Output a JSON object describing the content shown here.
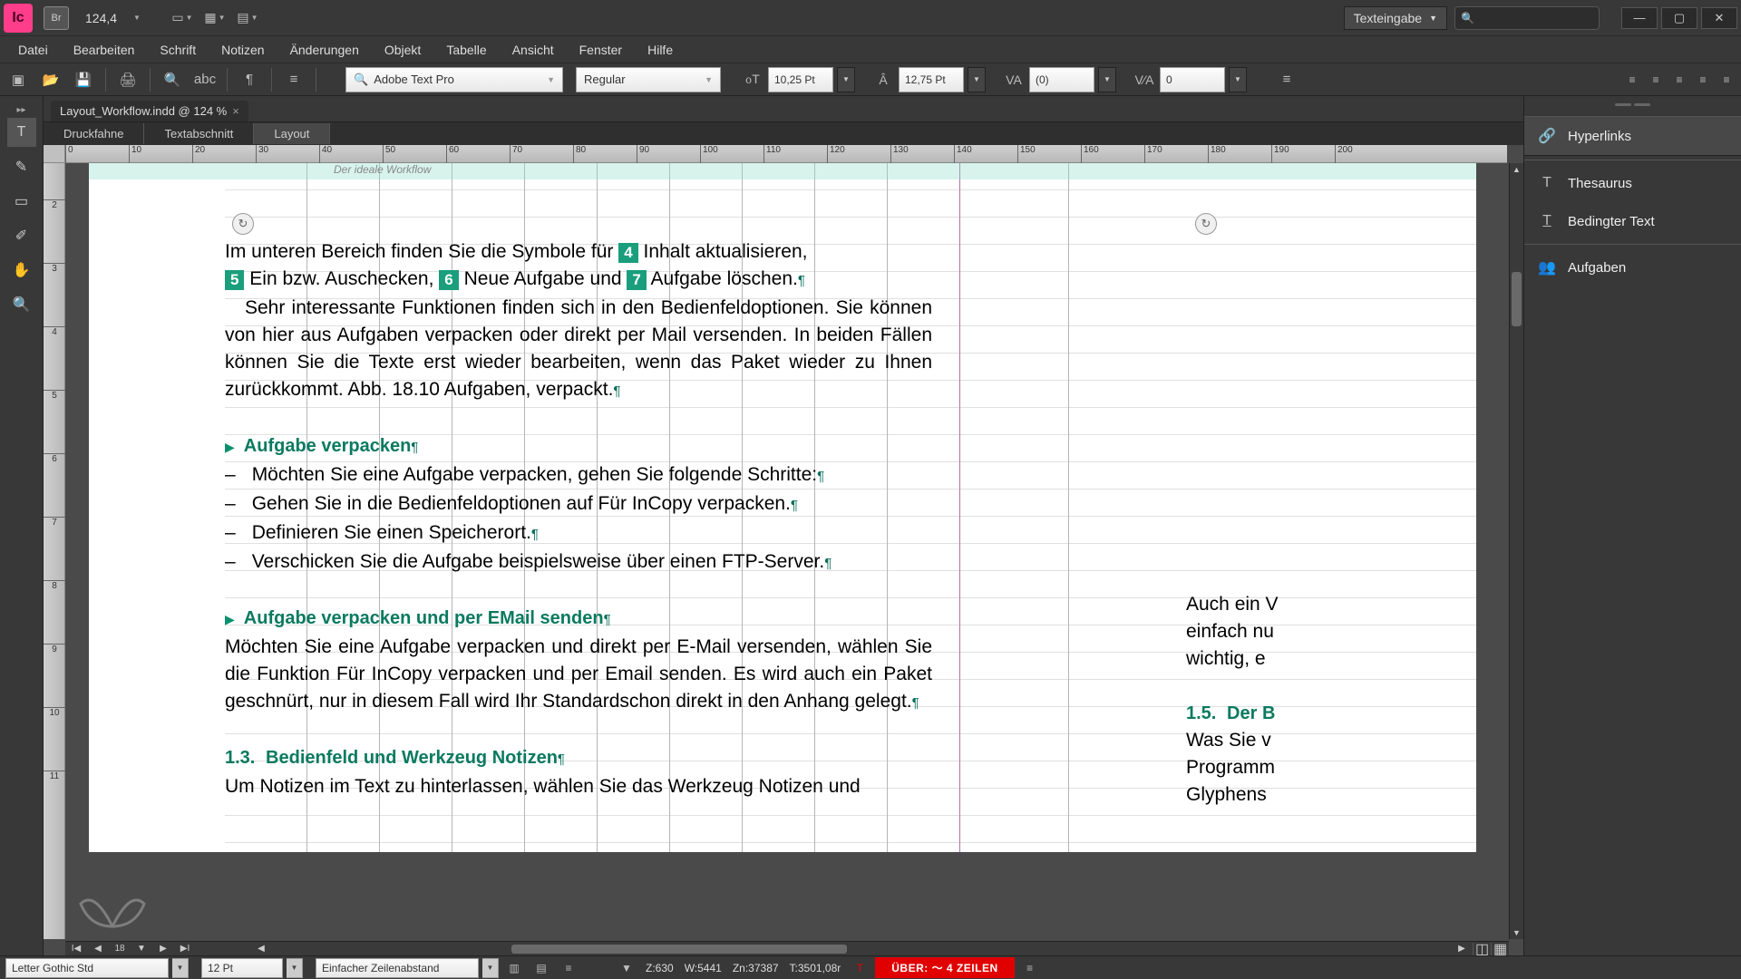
{
  "titlebar": {
    "app": "Ic",
    "bridge": "Br",
    "zoom": "124,4",
    "workspace": "Texteingabe"
  },
  "menu": [
    "Datei",
    "Bearbeiten",
    "Schrift",
    "Notizen",
    "Änderungen",
    "Objekt",
    "Tabelle",
    "Ansicht",
    "Fenster",
    "Hilfe"
  ],
  "control": {
    "font": "Adobe Text Pro",
    "style": "Regular",
    "size": "10,25 Pt",
    "leading": "12,75 Pt",
    "tracking": "(0)",
    "kerning": "0"
  },
  "doc_tab": "Layout_Workflow.indd @ 124 %",
  "view_tabs": [
    "Druckfahne",
    "Textabschnitt",
    "Layout"
  ],
  "page_head": "Der ideale Workflow",
  "ruler_h": [
    "0",
    "10",
    "20",
    "30",
    "40",
    "50",
    "60",
    "70",
    "80",
    "90",
    "100",
    "110",
    "120",
    "130",
    "140",
    "150",
    "160",
    "170",
    "180",
    "190",
    "200"
  ],
  "ruler_v": [
    "2",
    "3",
    "4",
    "5",
    "6",
    "7",
    "8",
    "9",
    "10",
    "11"
  ],
  "text": {
    "line1a": "Im unteren Bereich finden Sie die Symbole für ",
    "b4": "4",
    "line1b": " Inhalt aktualisieren, ",
    "b5": "5",
    "line2a": " Ein bzw. Auschecken, ",
    "b6": "6",
    "line2b": " Neue Aufgabe und ",
    "b7": "7",
    "line2c": " Aufgabe löschen.",
    "para2": "Sehr interessante Funktionen finden sich in den Bedienfeldoptionen. Sie können von hier aus Aufgaben verpacken oder direkt per Mail versenden. In beiden Fällen können Sie die Texte erst wieder bearbeiten, wenn das Paket wieder zu Ihnen zurückkommt. Abb. 18.10 Aufgaben, verpackt.",
    "h1": "Aufgabe verpacken",
    "li1": "Möchten Sie eine Aufgabe verpacken, gehen Sie folgende Schritte:",
    "li2": "Gehen Sie in die Bedienfeldoptionen auf Für InCopy verpacken.",
    "li3": "Definieren Sie einen Speicherort.",
    "li4": "Verschicken Sie die Aufgabe beispielsweise über einen FTP-Server.",
    "h2": "Aufgabe verpacken und per EMail senden",
    "para3": "Möchten Sie eine Aufgabe verpacken und direkt per E-Mail versenden, wählen Sie die Funktion Für InCopy verpacken und per Email senden. Es wird auch ein Paket geschnürt, nur in diesem Fall wird Ihr Standardschon direkt in den Anhang gelegt.",
    "secnum": "1.3.",
    "h3": "Bedienfeld und Werkzeug Notizen",
    "para4": "Um Notizen im Text zu hinterlassen, wählen Sie das Werkzeug Notizen und",
    "r1": "Auch ein V",
    "r2": "einfach nu",
    "r3": "wichtig, e",
    "rsec": "1.5.",
    "rh": "Der B",
    "r4": "Was Sie v",
    "r5": "Programm",
    "r6": "Glyphens"
  },
  "panels": [
    "Hyperlinks",
    "Thesaurus",
    "Bedingter Text",
    "Aufgaben"
  ],
  "status": {
    "font": "Letter Gothic Std",
    "size": "12 Pt",
    "leading": "Einfacher Zeilenabstand",
    "z": "Z:630",
    "w": "W:5441",
    "zn": "Zn:37387",
    "t": "T:3501,08r",
    "over": "ÜBER:  ～ 4 ZEILEN",
    "page": "18"
  }
}
